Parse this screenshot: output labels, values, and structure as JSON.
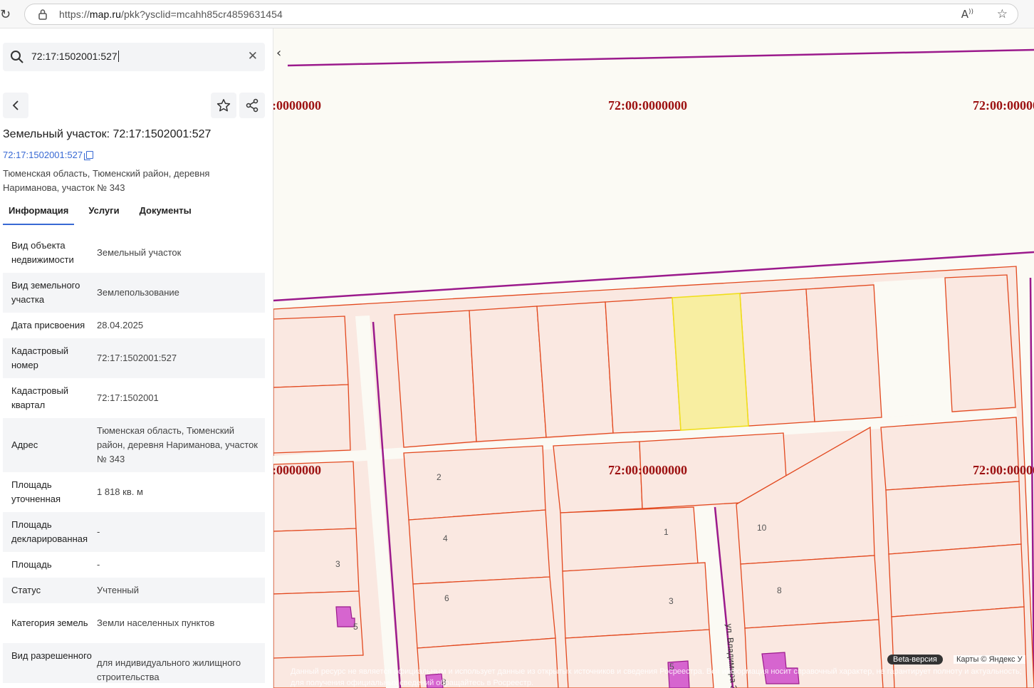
{
  "browser": {
    "url_prefix": "https://",
    "url_host": "map.ru",
    "url_path": "/pkk?ysclid=mcahh85cr4859631454",
    "read_aloud_label": "A̩",
    "favorite_label": "☆"
  },
  "panel": {
    "search_value": "72:17:1502001:527",
    "title": "Земельный участок: 72:17:1502001:527",
    "cadastral_link": "72:17:1502001:527",
    "address": "Тюменская область, Тюменский район, деревня Нариманова, участок № 343",
    "tabs": [
      "Информация",
      "Услуги",
      "Документы"
    ],
    "rows": [
      {
        "k": "Вид объекта недвижимости",
        "v": "Земельный участок"
      },
      {
        "k": "Вид земельного участка",
        "v": "Землепользование"
      },
      {
        "k": "Дата присвоения",
        "v": "28.04.2025"
      },
      {
        "k": "Кадастровый номер",
        "v": "72:17:1502001:527"
      },
      {
        "k": "Кадастровый квартал",
        "v": "72:17:1502001"
      },
      {
        "k": "Адрес",
        "v": "Тюменская область, Тюменский район, деревня Нариманова, участок № 343"
      },
      {
        "k": "Площадь уточненная",
        "v": "1 818 кв. м"
      },
      {
        "k": "Площадь декларированная",
        "v": "-"
      },
      {
        "k": "Площадь",
        "v": "-"
      },
      {
        "k": "Статус",
        "v": "Учтенный"
      },
      {
        "k": "Категория земель",
        "v": "Земли населенных пунктов"
      },
      {
        "k": "Вид разрешенного",
        "v": "для индивидуального жилищного строительства"
      }
    ]
  },
  "map": {
    "zone_labels": [
      ":0000000",
      "72:00:0000000",
      "72:00:0000000",
      ":0000000",
      "72:00:0000000",
      "72:00:0000000"
    ],
    "plot_numbers": [
      "2",
      "4",
      "6",
      "1",
      "3",
      "10",
      "8",
      "3",
      "5",
      "5",
      "8"
    ],
    "street_label": "ул. Владимира З",
    "beta_label": "Beta-версия",
    "attribution": "Карты © Яндекс   У",
    "disclaimer": "Данный ресурс не является официальным и использует данные из открытых источников и сведения Росреестра. Вся информация носит справочный характер, не гарантирует полноту и актуальность; для получения официальных сведений обращайтесь в Росреестр."
  },
  "colors": {
    "accent": "#3869d4",
    "plot_fill": "#fae8e1",
    "plot_stroke": "#e2481e",
    "selected_fill": "#f8eea1",
    "selected_stroke": "#f0de1a",
    "zone_line": "#9b1a8c",
    "zone_label": "#9c1010"
  }
}
